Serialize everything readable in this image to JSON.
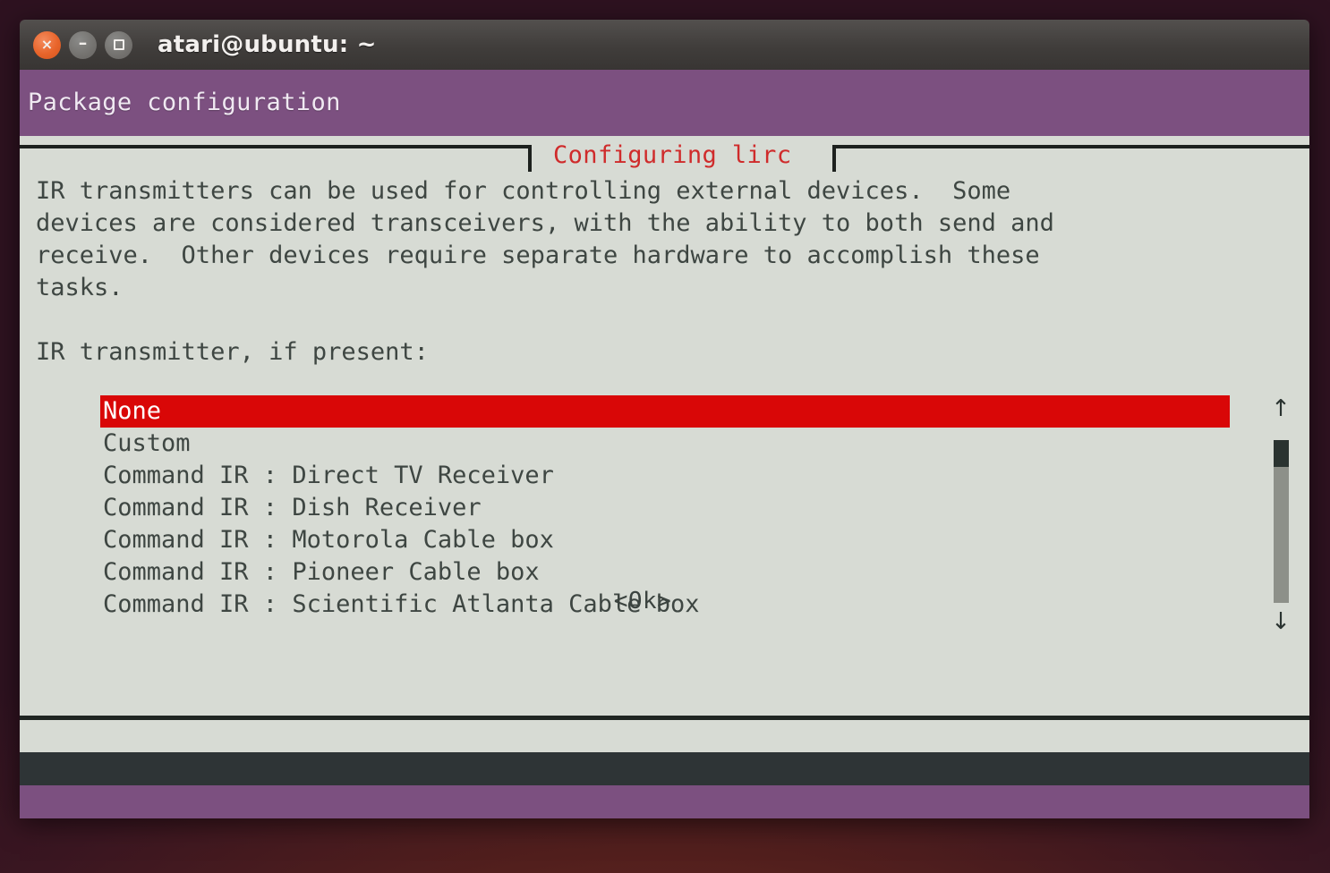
{
  "window": {
    "title": "atari@ubuntu: ~",
    "buttons": {
      "close": "×",
      "minimize": "–",
      "maximize": ""
    }
  },
  "terminal": {
    "package_header": "Package configuration",
    "dialog": {
      "title": "Configuring lirc",
      "body": "IR transmitters can be used for controlling external devices.  Some\ndevices are considered transceivers, with the ability to both send and\nreceive.  Other devices require separate hardware to accomplish these\ntasks.",
      "prompt": "IR transmitter, if present:",
      "options": [
        {
          "label": "None",
          "selected": true
        },
        {
          "label": "Custom",
          "selected": false
        },
        {
          "label": "Command IR : Direct TV Receiver",
          "selected": false
        },
        {
          "label": "Command IR : Dish Receiver",
          "selected": false
        },
        {
          "label": "Command IR : Motorola Cable box",
          "selected": false
        },
        {
          "label": "Command IR : Pioneer Cable box",
          "selected": false
        },
        {
          "label": "Command IR : Scientific Atlanta Cable box",
          "selected": false
        }
      ],
      "scrollbar": {
        "up_arrow": "↑",
        "down_arrow": "↓"
      },
      "ok_button": "<Ok>"
    }
  },
  "colors": {
    "selection_red": "#d90707",
    "title_red": "#cf2b2b",
    "dialog_bg": "#d7dbd4",
    "header_purple": "#7c5080",
    "text": "#3e4642",
    "titlebar": "#403d3b",
    "bottom_dark": "#2e3436",
    "desktop": "#521f1d"
  }
}
